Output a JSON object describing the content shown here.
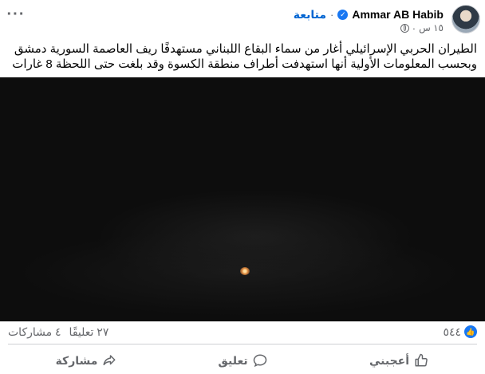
{
  "header": {
    "author_name": "Ammar AB Habib",
    "follow_label": "متابعة",
    "dot": "·",
    "time": "١٥ س",
    "more_icon": "···"
  },
  "post": {
    "text": "الطيران الحربي الإسرائيلي أغار من سماء البقاع اللبناني مستهدفًا ريف العاصمة السورية دمشق وبحسب المعلومات الأولية أنها استهدفت أطراف منطقة الكسوة وقد بلغت حتى اللحظة 8 غارات"
  },
  "stats": {
    "reactions_count": "٥٤٤",
    "comments": "٢٧ تعليقًا",
    "shares": "٤ مشاركات"
  },
  "actions": {
    "like": "أعجبني",
    "comment": "تعليق",
    "share": "مشاركة"
  },
  "colors": {
    "accent": "#1877f2",
    "link": "#0064d1",
    "muted": "#65676b",
    "media_bg": "#0d0d0d"
  }
}
